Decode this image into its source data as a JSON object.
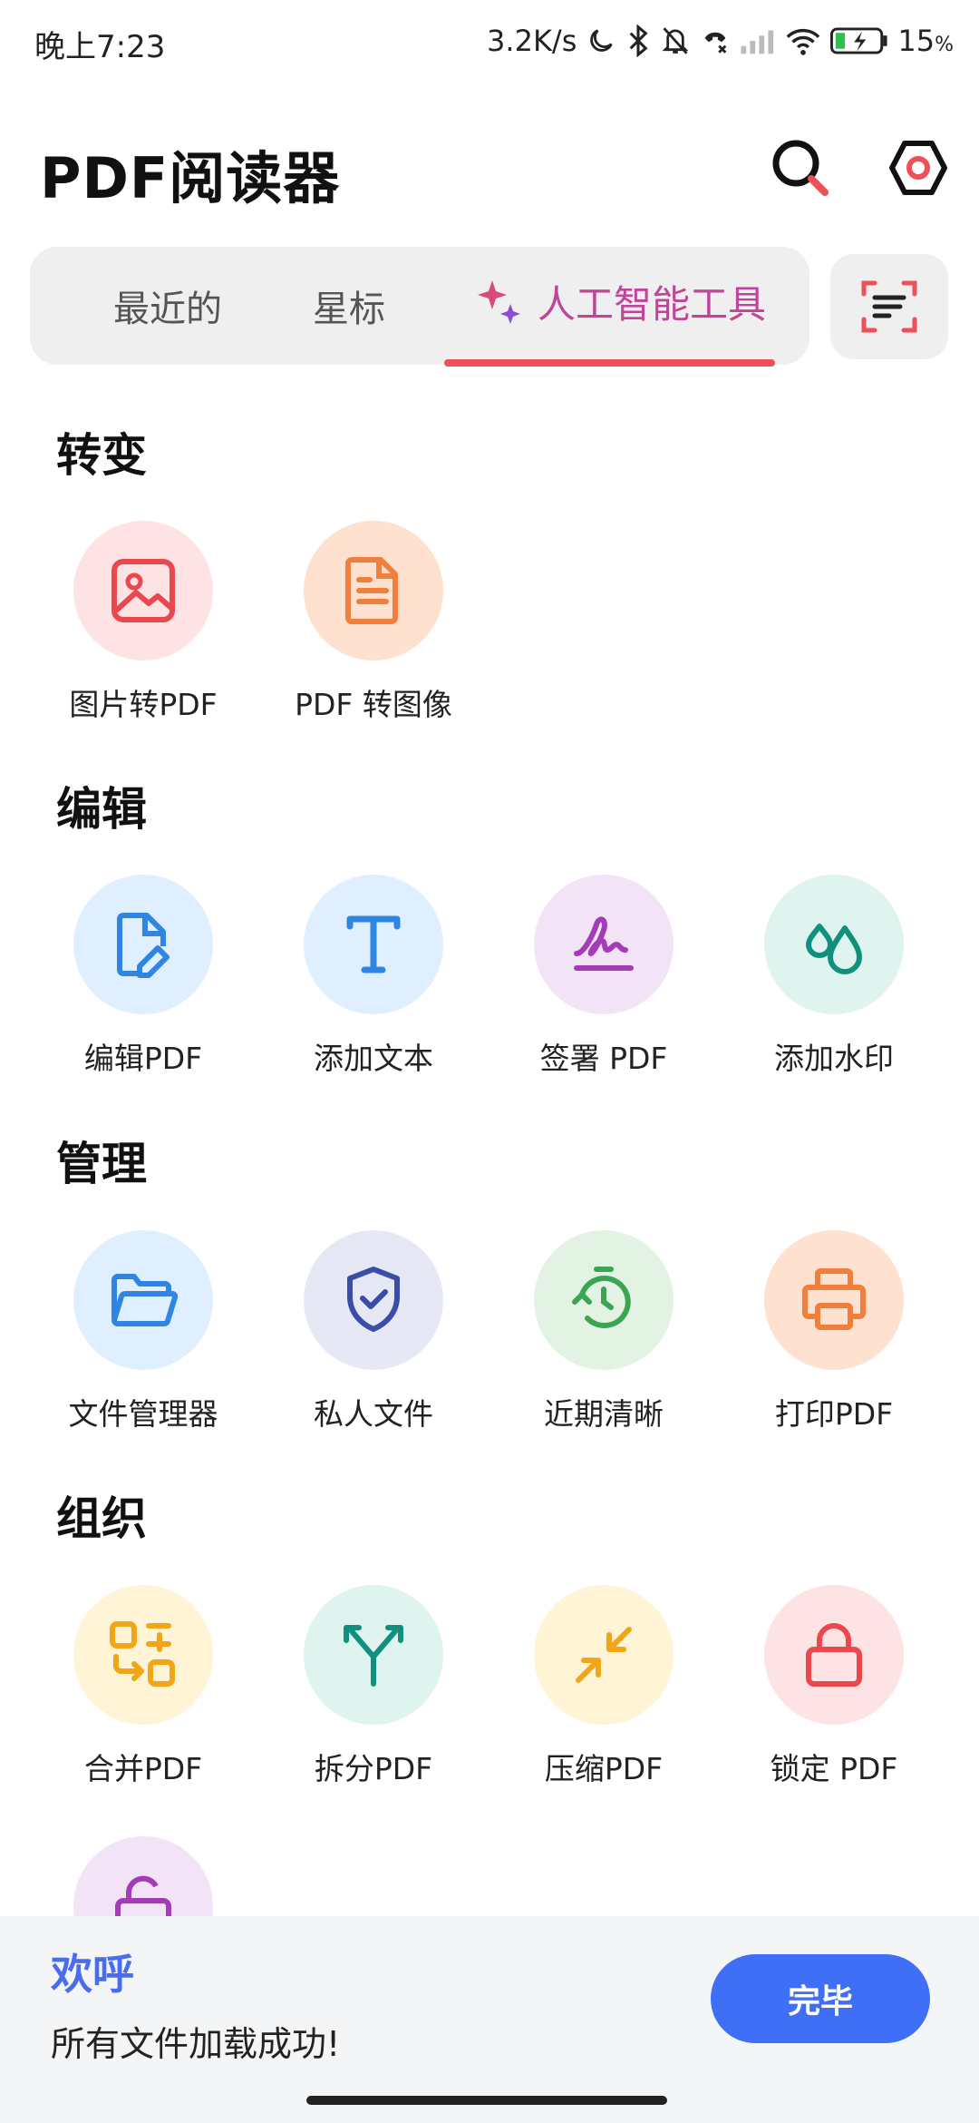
{
  "status": {
    "time": "晚上7:23",
    "net_speed": "3.2K/s",
    "battery": "15",
    "battery_unit": "%"
  },
  "header": {
    "title": "PDF阅读器"
  },
  "tabs": {
    "recent": "最近的",
    "starred": "星标",
    "ai_tools": "人工智能工具"
  },
  "sections": {
    "convert": {
      "title": "转变",
      "items": [
        {
          "label": "图片转PDF",
          "icon": "image-icon"
        },
        {
          "label": "PDF 转图像",
          "icon": "document-icon"
        }
      ]
    },
    "edit": {
      "title": "编辑",
      "items": [
        {
          "label": "编辑PDF",
          "icon": "edit-document-icon"
        },
        {
          "label": "添加文本",
          "icon": "text-icon"
        },
        {
          "label": "签署 PDF",
          "icon": "signature-icon"
        },
        {
          "label": "添加水印",
          "icon": "watermark-drops-icon"
        }
      ]
    },
    "manage": {
      "title": "管理",
      "items": [
        {
          "label": "文件管理器",
          "icon": "folder-icon"
        },
        {
          "label": "私人文件",
          "icon": "shield-check-icon"
        },
        {
          "label": "近期清晰",
          "icon": "timer-icon"
        },
        {
          "label": "打印PDF",
          "icon": "printer-icon"
        }
      ]
    },
    "organize": {
      "title": "组织",
      "items": [
        {
          "label": "合并PDF",
          "icon": "merge-icon"
        },
        {
          "label": "拆分PDF",
          "icon": "split-icon"
        },
        {
          "label": "压缩PDF",
          "icon": "compress-icon"
        },
        {
          "label": "锁定 PDF",
          "icon": "lock-icon"
        }
      ]
    }
  },
  "toast": {
    "title": "欢呼",
    "message": "所有文件加载成功!",
    "button": "完毕"
  },
  "colors": {
    "accent_red": "#ef4f57",
    "ai_pink": "#c0449a",
    "primary_blue": "#3f6ef7"
  }
}
